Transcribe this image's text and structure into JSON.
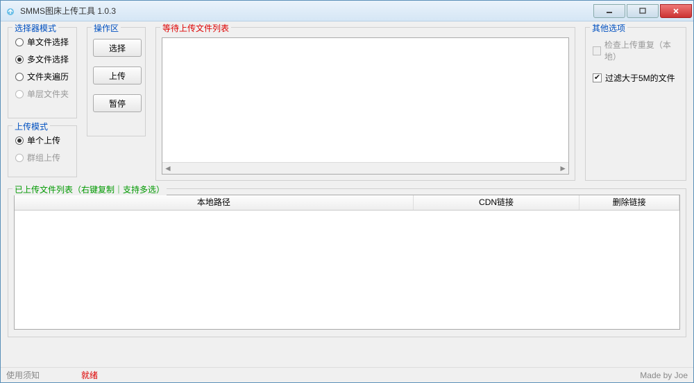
{
  "window": {
    "title": "SMMS图床上传工具 1.0.3"
  },
  "selector_mode": {
    "title": "选择器模式",
    "options": [
      {
        "label": "单文件选择",
        "selected": false,
        "disabled": false
      },
      {
        "label": "多文件选择",
        "selected": true,
        "disabled": false
      },
      {
        "label": "文件夹遍历",
        "selected": false,
        "disabled": false
      },
      {
        "label": "单层文件夹",
        "selected": false,
        "disabled": true
      }
    ]
  },
  "upload_mode": {
    "title": "上传模式",
    "options": [
      {
        "label": "单个上传",
        "selected": true,
        "disabled": false
      },
      {
        "label": "群组上传",
        "selected": false,
        "disabled": true
      }
    ]
  },
  "ops": {
    "title": "操作区",
    "select_btn": "选择",
    "upload_btn": "上传",
    "pause_btn": "暂停"
  },
  "pending": {
    "title": "等待上传文件列表"
  },
  "other": {
    "title": "其他选项",
    "check_dup": "检查上传重复（本地）",
    "check_dup_checked": false,
    "check_dup_disabled": true,
    "filter_5m": "过滤大于5M的文件",
    "filter_5m_checked": true
  },
  "uploaded": {
    "title": "已上传文件列表（右键复制｜支持多选）",
    "columns": [
      {
        "label": "本地路径",
        "width": "60%"
      },
      {
        "label": "CDN链接",
        "width": "25%"
      },
      {
        "label": "删除链接",
        "width": "15%"
      }
    ]
  },
  "statusbar": {
    "instructions": "使用须知",
    "ready": "就绪",
    "author": "Made by Joe"
  },
  "scroll": {
    "left": "◄",
    "right": "►"
  }
}
